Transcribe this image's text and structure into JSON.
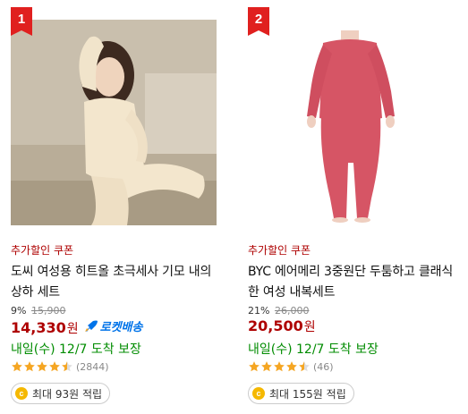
{
  "products": [
    {
      "rank": "1",
      "coupon_flag": "추가할인 쿠폰",
      "title": "도씨 여성용 히트올 초극세사 기모 내의 상하 세트",
      "discount_rate": "9%",
      "original_price": "15,900",
      "price": "14,330",
      "won": "원",
      "rocket_label": "로켓배송",
      "delivery": "내일(수) 12/7 도착 보장",
      "rating": 4.5,
      "review_count": "(2844)",
      "reward": "최대 93원 적립",
      "coin_symbol": "c",
      "image_icon": "woman-beige-thermal-set-photo"
    },
    {
      "rank": "2",
      "coupon_flag": "추가할인 쿠폰",
      "title": "BYC 에어메리 3중원단 두툼하고 클래식한 여성 내복세트",
      "discount_rate": "21%",
      "original_price": "26,000",
      "price": "20,500",
      "won": "원",
      "rocket_label": "",
      "delivery": "내일(수) 12/7 도착 보장",
      "rating": 4.5,
      "review_count": "(46)",
      "reward": "최대 155원 적립",
      "coin_symbol": "c",
      "image_icon": "woman-pink-thermal-set-photo"
    }
  ],
  "colors": {
    "rank_badge": "#e0201f",
    "price": "#ae0000",
    "delivery": "#008c00",
    "rocket": "#0073e9",
    "star": "#f5a623"
  }
}
